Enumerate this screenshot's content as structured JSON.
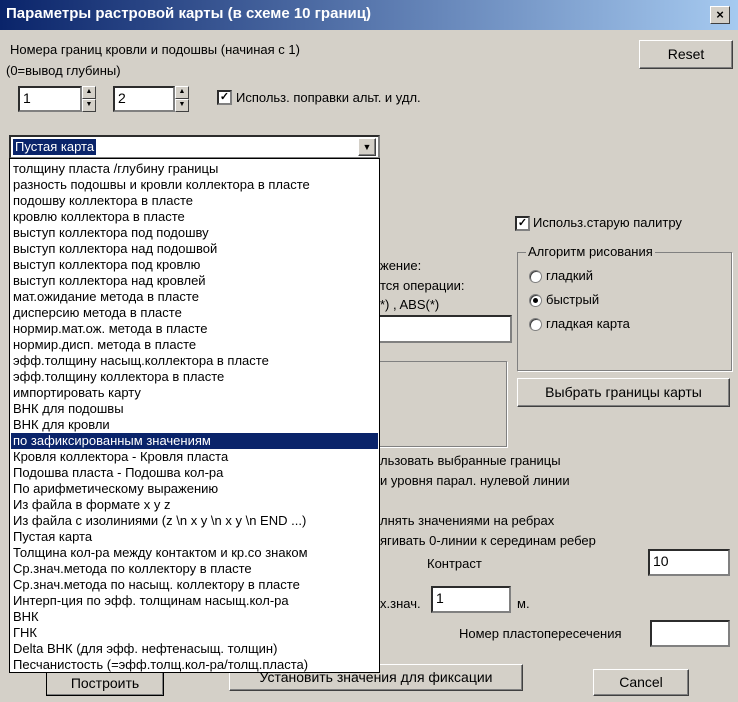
{
  "window": {
    "title": "Параметры растровой карты (в схеме 10 границ)",
    "close_label": "×"
  },
  "header": {
    "label_line1": "Номера границ кровли и подошвы  (начиная с 1)",
    "label_line2": "(0=вывод глубины)",
    "roof_value": "1",
    "sole_value": "2",
    "use_corrections_label": "Использ. поправки альт. и удл.",
    "use_corrections_checked": true,
    "reset_label": "Reset"
  },
  "map_type": {
    "selected": "Пустая карта",
    "options": [
      "толщину пласта /глубину границы",
      "разность подошвы и кровли коллектора в пласте",
      "подошву коллектора в пласте",
      "кровлю коллектора в пласте",
      "выступ коллектора под подошву",
      "выступ коллектора над подошвой",
      "выступ коллектора под кровлю",
      "выступ коллектора над кровлей",
      "мат.ожидание метода в пласте",
      "дисперсию метода в пласте",
      "нормир.мат.ож. метода в пласте",
      "нормир.дисп. метода в пласте",
      "эфф.толщину насыщ.коллектора в пласте",
      "эфф.толщину коллектора в пласте",
      "импортировать карту",
      "ВНК для подошвы",
      "ВНК для кровли",
      "по зафиксированным значениям",
      "Кровля коллектора - Кровля пласта",
      "Подошва пласта - Подошва кол-ра",
      "По арифметическому выражению",
      "Из файла в формате x y z",
      "Из файла с изолиниями (z \\n x y \\n x y \\n END ...)",
      "Пустая карта",
      "Толщина кол-ра между контактом и кр.со знаком",
      "Ср.знач.метода по коллектору в пласте",
      "Ср.знач.метода по насыщ. коллектору в пласте",
      "Интерп-ция по эфф. толщинам насыщ.кол-ра",
      "ВНК",
      "ГНК",
      "Delta ВНК (для эфф. нефтенасыщ. толщин)",
      "Песчанистость (=эфф.толщ.кол-ра/толщ.пласта)"
    ],
    "highlighted_index": 17
  },
  "right_panel": {
    "old_palette_label": "Использ.старую палитру",
    "old_palette_checked": true,
    "algorithm_title": "Алгоритм рисования",
    "algorithms": [
      "гладкий",
      "быстрый",
      "гладкая карта"
    ],
    "algorithm_selected": 1,
    "choose_bounds_label": "Выбрать границы карты"
  },
  "partial_texts": {
    "expr1": "жение:",
    "expr2": "тся операции:",
    "expr3": "*) , ABS(*)",
    "use_bounds": "льзовать выбранные границы",
    "zero_line": "и уровня парал. нулевой линии",
    "fill_edges": "лнять значениями на ребрах",
    "pull_zero": "ягивать 0-линии к серединам ребер",
    "max_val": "х.знач."
  },
  "contrast": {
    "label": "Контраст",
    "value": "10"
  },
  "max_value": {
    "value": "1",
    "unit": "м."
  },
  "intersection": {
    "label": "Номер пластопересечения",
    "value": ""
  },
  "buttons": {
    "build": "Построить",
    "set_fix": "Установить значения для фиксации",
    "cancel": "Cancel"
  }
}
